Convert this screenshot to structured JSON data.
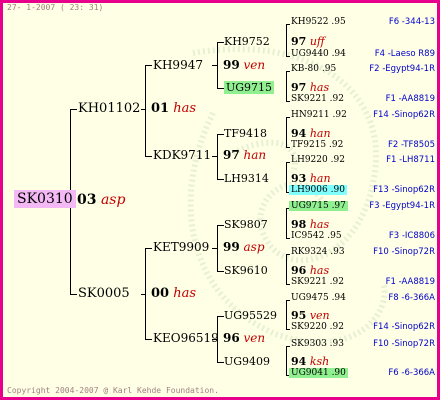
{
  "header": {
    "timestamp": "27-  1-2007 ( 23: 31)"
  },
  "footer": {
    "copyright": "Copyright 2004-2007 @ Karl Kehde Foundation."
  },
  "colors": {
    "frame_border": "#e8008c",
    "background": "#ffffe6",
    "note": "#c00000",
    "location": "#0000cc",
    "highlight_pink": "#f4b8f4",
    "highlight_green": "#90f090",
    "highlight_cyan": "#80ffff"
  },
  "root": {
    "name": "SK0310",
    "score": "03",
    "note": "asp"
  },
  "gen1": [
    {
      "name": "KH01102",
      "score": "01",
      "note": "has"
    },
    {
      "name": "SK0005",
      "score": "00",
      "note": "has"
    }
  ],
  "gen2": [
    {
      "name": "KH9947",
      "score": "99",
      "note": "ven"
    },
    {
      "name": "KDK9711",
      "score": "97",
      "note": "han"
    },
    {
      "name": "KET9909",
      "score": "99",
      "note": "asp"
    },
    {
      "name": "KEO96519",
      "score": "96",
      "note": "ven"
    }
  ],
  "gen3": [
    {
      "name": "KH9752",
      "score": "97",
      "note": "uff"
    },
    {
      "name": "UG9715",
      "score": "97",
      "note": "has"
    },
    {
      "name": "TF9418",
      "score": "94",
      "note": "han"
    },
    {
      "name": "LH9314",
      "score": "93",
      "note": "han"
    },
    {
      "name": "SK9807",
      "score": "98",
      "note": "has"
    },
    {
      "name": "SK9610",
      "score": "96",
      "note": "has"
    },
    {
      "name": "UG95529",
      "score": "95",
      "note": "ven"
    },
    {
      "name": "UG9409",
      "score": "94",
      "note": "ksh"
    }
  ],
  "gen4": [
    {
      "name": "KH9522",
      "year": ".95",
      "loc": "F6 -344-13"
    },
    {
      "name": "UG9440",
      "year": ".94",
      "loc": "F4 -Laeso R89"
    },
    {
      "name": "KB-80",
      "year": ".95",
      "loc": "F2 -Egypt94-1R"
    },
    {
      "name": "SK9221",
      "year": ".92",
      "loc": "F1 -AA8819"
    },
    {
      "name": "HN9211",
      "year": ".92",
      "loc": "F14 -Sinop62R"
    },
    {
      "name": "TF9215",
      "year": ".92",
      "loc": "F2 -TF8505"
    },
    {
      "name": "LH9220",
      "year": ".92",
      "loc": "F1 -LH8711"
    },
    {
      "name": "LH9006",
      "year": ".90",
      "loc": "F13 -Sinop62R"
    },
    {
      "name": "UG9715",
      "year": ".97",
      "loc": "F3 -Egypt94-1R"
    },
    {
      "name": "IC9542",
      "year": ".95",
      "loc": "F3 -IC8806"
    },
    {
      "name": "RK9324",
      "year": ".93",
      "loc": "F10 -Sinop72R"
    },
    {
      "name": "SK9221",
      "year": ".92",
      "loc": "F1 -AA8819"
    },
    {
      "name": "UG9475",
      "year": ".94",
      "loc": "F8 -6-366A"
    },
    {
      "name": "SK9220",
      "year": ".92",
      "loc": "F14 -Sinop62R"
    },
    {
      "name": "SK9303",
      "year": ".93",
      "loc": "F10 -Sinop72R"
    },
    {
      "name": "UG9041",
      "year": ".90",
      "loc": "F6 -6-366A"
    }
  ]
}
